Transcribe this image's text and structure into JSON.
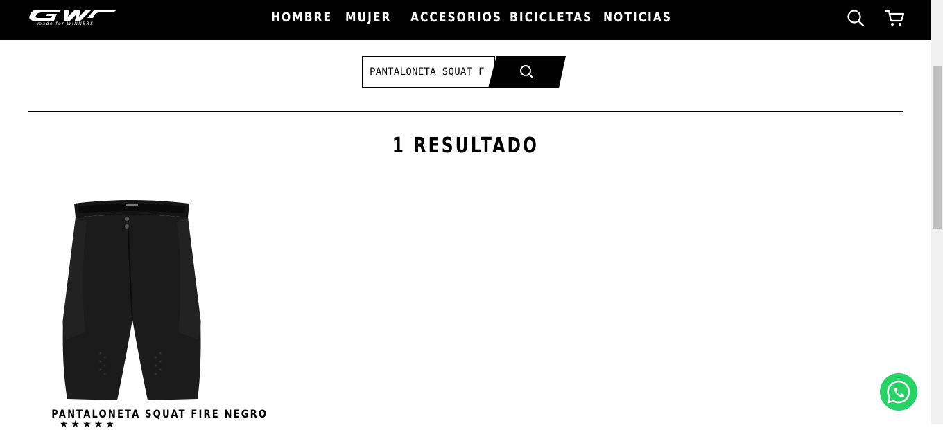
{
  "brand": {
    "logo_text": "GW",
    "tagline": "made for WINNERS"
  },
  "nav": {
    "items": [
      {
        "label": "HOMBRE"
      },
      {
        "label": "MUJER"
      },
      {
        "label": "ACCESORIOS"
      },
      {
        "label": "BICICLETAS"
      },
      {
        "label": "NOTICIAS"
      }
    ],
    "icons": {
      "search": "search-icon",
      "cart": "cart-icon"
    }
  },
  "search": {
    "value": "PANTALONETA SQUAT F",
    "button_icon": "search-icon"
  },
  "results": {
    "title": "1 RESULTADO"
  },
  "products": [
    {
      "name": "PANTALONETA SQUAT FIRE NEGRO",
      "rating_stars": "★★★★★",
      "image": "black-cycling-shorts"
    }
  ],
  "whatsapp": {
    "icon": "whatsapp-icon"
  },
  "colors": {
    "header_bg": "#000000",
    "page_bg": "#ffffff",
    "text": "#000000",
    "whatsapp_green": "#25d366"
  }
}
